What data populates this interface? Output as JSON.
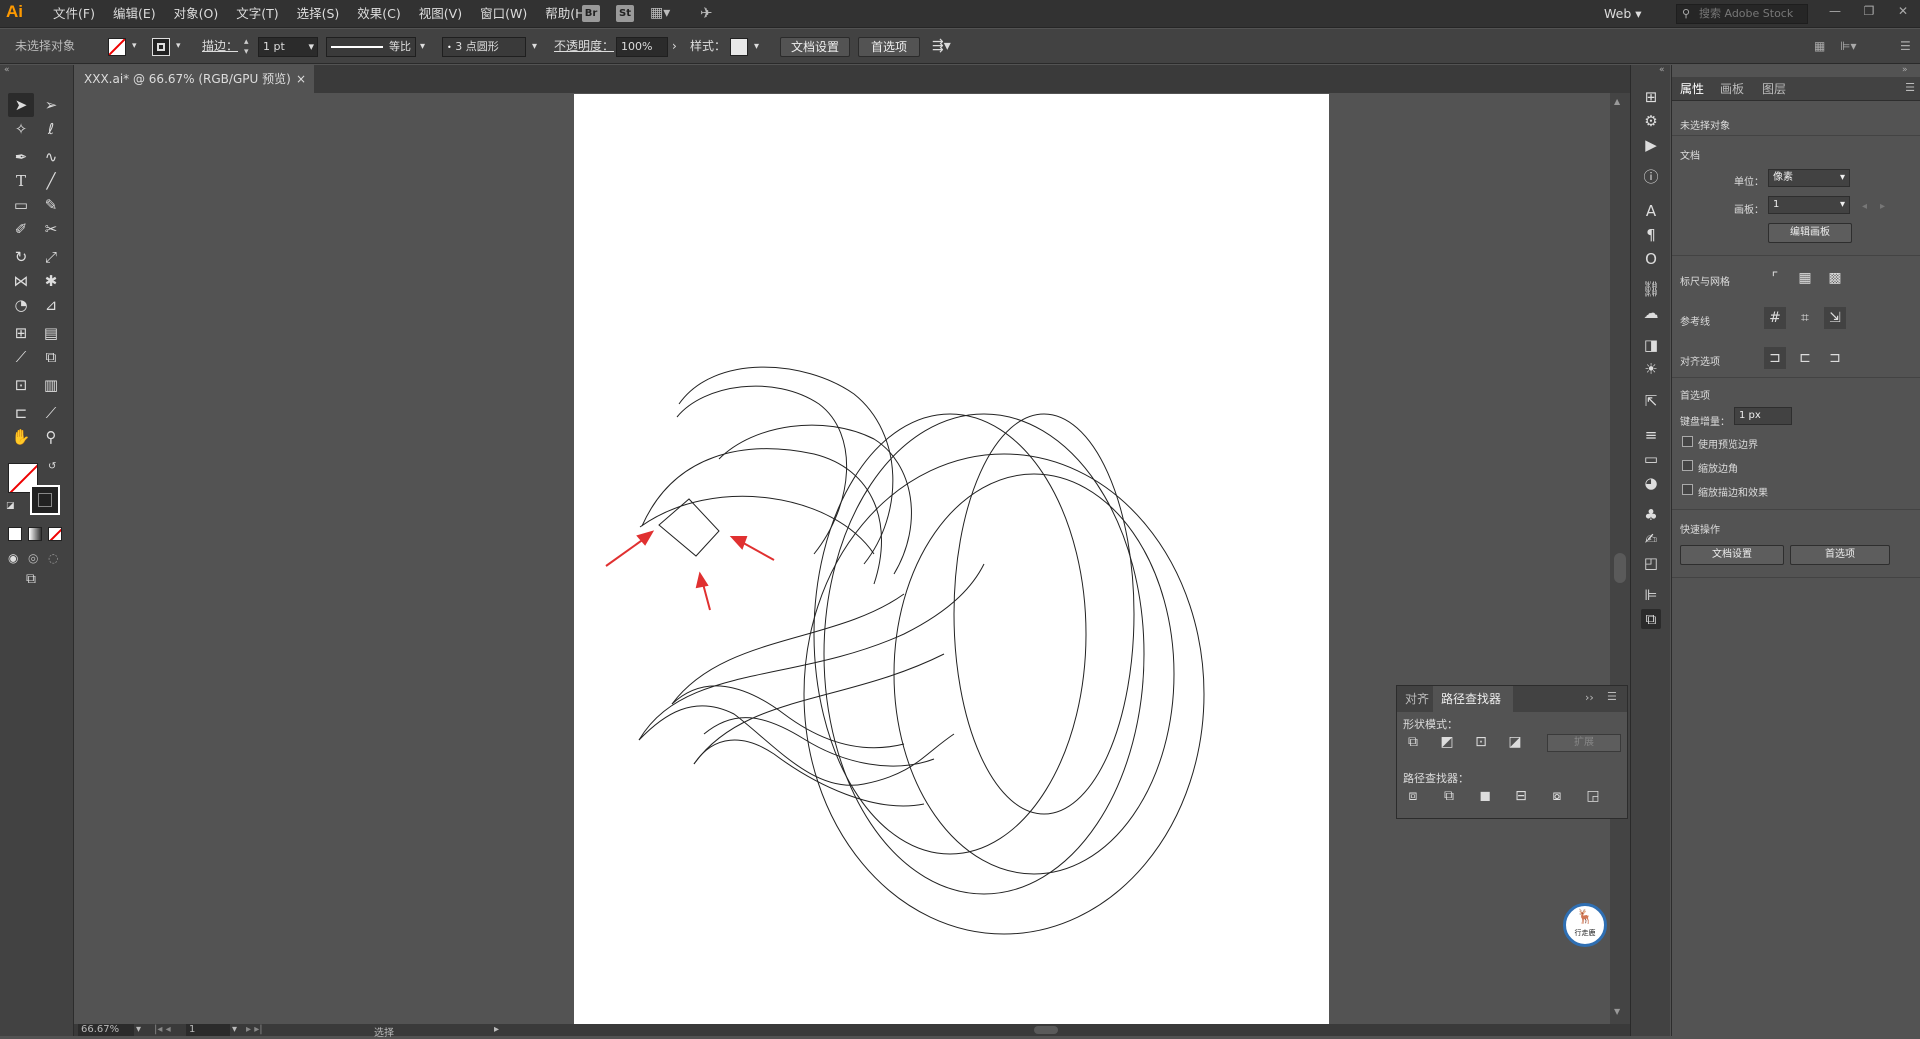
{
  "app": {
    "logo": "Ai",
    "workspace": "Web",
    "stock_placeholder": "搜索 Adobe Stock"
  },
  "menu": [
    "文件(F)",
    "编辑(E)",
    "对象(O)",
    "文字(T)",
    "选择(S)",
    "效果(C)",
    "视图(V)",
    "窗口(W)",
    "帮助(H)"
  ],
  "menu_icons": {
    "br": "Br",
    "st": "St"
  },
  "control": {
    "selection": "未选择对象",
    "stroke_label": "描边：",
    "stroke_value": "1 pt",
    "profile": "等比",
    "brush": "3 点圆形",
    "opacity_label": "不透明度：",
    "opacity_value": "100%",
    "style_label": "样式：",
    "doc_setup": "文档设置",
    "prefs": "首选项"
  },
  "document": {
    "tab_title": "XXX.ai* @ 66.67% (RGB/GPU 预览)",
    "close": "×"
  },
  "status": {
    "zoom": "66.67%",
    "artboard": "1",
    "tool": "选择"
  },
  "panel": {
    "tabs": [
      "属性",
      "画板",
      "图层"
    ],
    "no_selection": "未选择对象",
    "doc_section": "文档",
    "unit_label": "单位：",
    "unit_value": "像素",
    "artboard_label": "画板：",
    "artboard_value": "1",
    "edit_artboard": "编辑画板",
    "rulers_grids": "标尺与网格",
    "guides": "参考线",
    "snap_options": "对齐选项",
    "prefs_section": "首选项",
    "keyboard_increment_label": "键盘增量：",
    "keyboard_increment_value": "1 px",
    "use_preview_bounds": "使用预览边界",
    "scale_corners": "缩放边角",
    "scale_strokes": "缩放描边和效果",
    "quick_actions": "快速操作",
    "doc_setup_btn": "文档设置",
    "prefs_btn": "首选项"
  },
  "pathfinder": {
    "tabs": [
      "对齐",
      "路径查找器"
    ],
    "shape_modes": "形状模式：",
    "expand": "扩展",
    "pathfinders": "路径查找器："
  },
  "badge": {
    "text": "行走鹿"
  },
  "colors": {
    "accent": "#ff9a00",
    "arrow": "#e03030",
    "badge_ring": "#2f6fb3"
  }
}
